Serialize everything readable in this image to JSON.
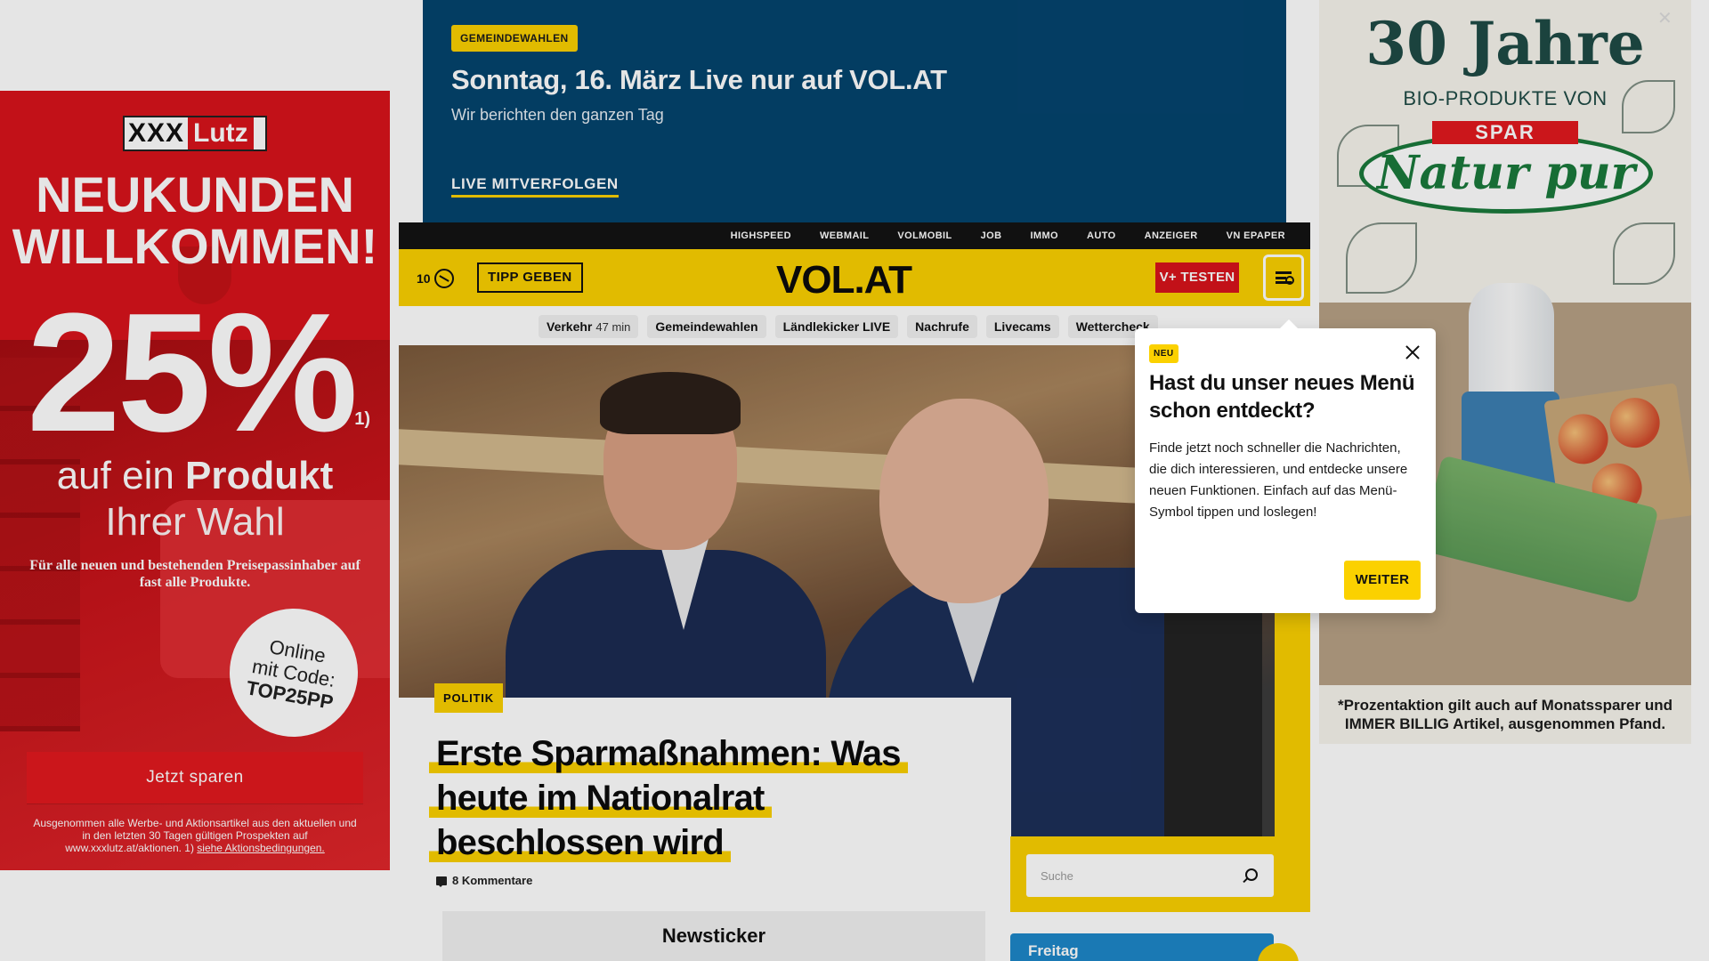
{
  "ad_left": {
    "brand_a": "XXX",
    "brand_b": "Lutz",
    "headline_1": "NEUKUNDEN",
    "headline_2": "WILLKOMMEN!",
    "percent": "25%",
    "footnote_mark": "1)",
    "product_line_1a": "auf ein ",
    "product_line_1b": "Produkt",
    "product_line_2": "Ihrer Wahl",
    "note": "Für alle neuen und bestehenden Preisepassinhaber auf fast alle Produkte.",
    "circle_1": "Online",
    "circle_2": "mit Code:",
    "circle_code": "TOP25PP",
    "cta": "Jetzt sparen",
    "small_1": "Ausgenommen alle Werbe- und Aktionsartikel aus den aktuellen und in den letzten 30 Tagen gültigen Prospekten auf www.xxxlutz.at/aktionen. 1) ",
    "small_link": "siehe Aktionsbedingungen."
  },
  "ad_right": {
    "title": "30 Jahre",
    "subtitle": "BIO-PRODUKTE VON",
    "spar": "SPAR",
    "brand": "Natur pur",
    "note": "*Prozentaktion gilt auch auf Monatssparer und IMMER BILLIG Artikel, ausgenommen Pfand.",
    "close": "✕"
  },
  "live_banner": {
    "tag": "GEMEINDEWAHLEN",
    "title": "Sonntag, 16. März Live nur auf VOL.AT",
    "subtitle": "Wir berichten den ganzen Tag",
    "link": "LIVE MITVERFOLGEN"
  },
  "util_nav": [
    "HIGHSPEED",
    "WEBMAIL",
    "VOLMOBIL",
    "JOB",
    "IMMO",
    "AUTO",
    "ANZEIGER",
    "VN EPAPER"
  ],
  "header": {
    "temperature": "10",
    "tipp": "TIPP GEBEN",
    "logo": "VOL.AT",
    "vplus": "V+ TESTEN"
  },
  "quick_links": [
    {
      "label": "Verkehr",
      "extra": "47 min"
    },
    {
      "label": "Gemeindewahlen",
      "extra": ""
    },
    {
      "label": "Ländlekicker LIVE",
      "extra": ""
    },
    {
      "label": "Nachrufe",
      "extra": ""
    },
    {
      "label": "Livecams",
      "extra": ""
    },
    {
      "label": "Wettercheck",
      "extra": ""
    }
  ],
  "article": {
    "category": "POLITIK",
    "headline": "Erste Sparmaßnahmen: Was heute im Nationalrat beschlossen wird",
    "comments": "8 Kommentare"
  },
  "newsticker": "Newsticker",
  "search": {
    "placeholder": "Suche"
  },
  "weather": {
    "day": "Freitag"
  },
  "popover": {
    "tag": "NEU",
    "title": "Hast du unser neues Menü schon entdeckt?",
    "text": "Finde jetzt noch schneller die Nachrichten, die dich interessieren, und entdecke unsere neuen Funktionen. Einfach auf das Menü-Symbol tippen und loslegen!",
    "button": "WEITER"
  },
  "colors": {
    "brand_yellow": "#fbd100",
    "live_banner": "#04446e",
    "ad_red": "#d8141b",
    "util_bar": "#141414"
  }
}
